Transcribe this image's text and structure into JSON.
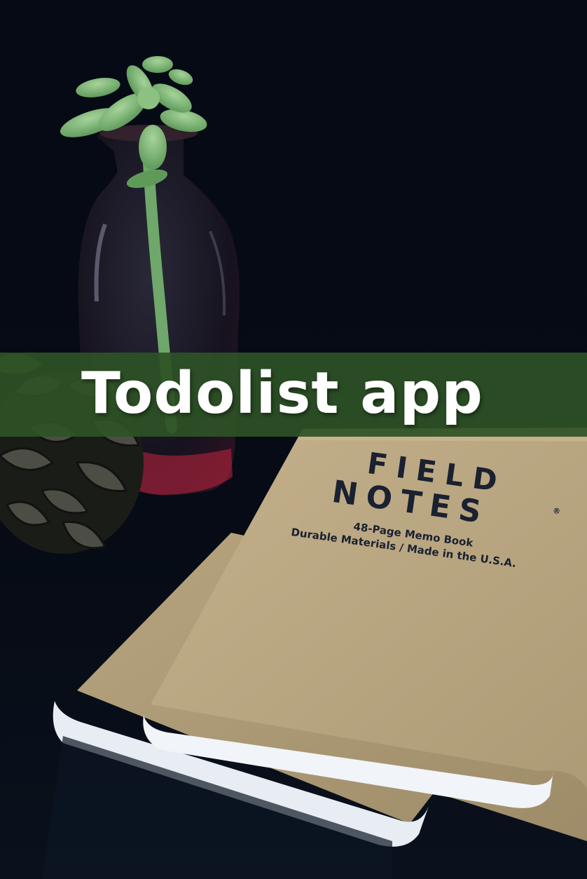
{
  "banner": {
    "title": "Todolist app",
    "color": "#2e5226"
  },
  "notebook": {
    "brand_line1": "FIELD",
    "brand_line2": "NOTES",
    "registered": "®",
    "tagline1": "48-Page Memo Book",
    "tagline2": "Durable Materials / Made in the U.S.A."
  },
  "palette": {
    "background": "#04080f",
    "kraft": "#b9a784",
    "succulent": "#7fb07a"
  }
}
